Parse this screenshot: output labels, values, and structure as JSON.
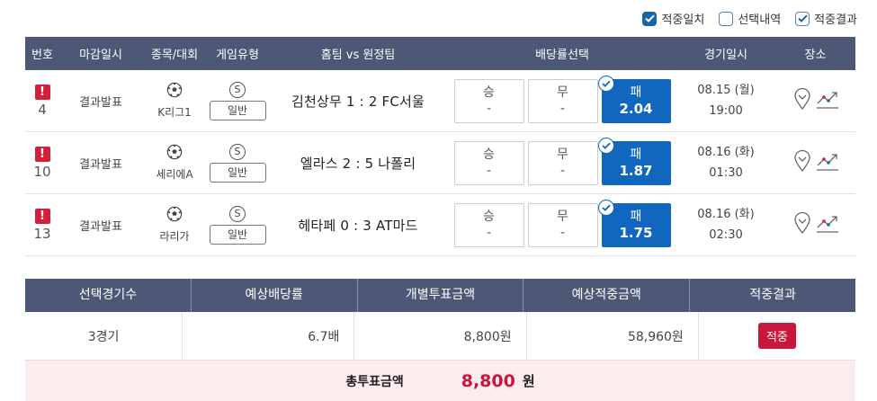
{
  "filters": [
    {
      "label": "적중일치",
      "checked": true
    },
    {
      "label": "선택내역",
      "checked": false
    },
    {
      "label": "적중결과",
      "checked": true
    }
  ],
  "match_table": {
    "headers": [
      "번호",
      "마감일시",
      "종목/대회",
      "게임유형",
      "홈팀 vs 원정팀",
      "배당률선택",
      "경기일시",
      "장소"
    ],
    "rows": [
      {
        "no": "4",
        "deadline": "결과발표",
        "league": "K리그1",
        "game_mark": "S",
        "game_type": "일반",
        "match": "김천상무 1 : 2 FC서울",
        "win_label": "승",
        "win_value": "-",
        "draw_label": "무",
        "draw_value": "-",
        "lose_label": "패",
        "lose_value": "2.04",
        "date": "08.15 (월)",
        "time": "19:00"
      },
      {
        "no": "10",
        "deadline": "결과발표",
        "league": "세리에A",
        "game_mark": "S",
        "game_type": "일반",
        "match": "엘라스 2 : 5 나폴리",
        "win_label": "승",
        "win_value": "-",
        "draw_label": "무",
        "draw_value": "-",
        "lose_label": "패",
        "lose_value": "1.87",
        "date": "08.16 (화)",
        "time": "01:30"
      },
      {
        "no": "13",
        "deadline": "결과발표",
        "league": "라리가",
        "game_mark": "S",
        "game_type": "일반",
        "match": "헤타페 0 : 3 AT마드",
        "win_label": "승",
        "win_value": "-",
        "draw_label": "무",
        "draw_value": "-",
        "lose_label": "패",
        "lose_value": "1.75",
        "date": "08.16 (화)",
        "time": "02:30"
      }
    ]
  },
  "summary": {
    "headers": [
      "선택경기수",
      "예상배당률",
      "개별투표금액",
      "예상적중금액",
      "적중결과"
    ],
    "games": "3경기",
    "odds": "6.7배",
    "bet_amount": "8,800원",
    "expected_win": "58,960원",
    "result": "적중",
    "total_label": "총투표금액",
    "total_value": "8,800",
    "total_unit": "원"
  },
  "colors": {
    "header": "#4d5876",
    "selected": "#1067bd",
    "hit": "#c8163c",
    "warn": "#d21f3c"
  },
  "icons": [
    "checkbox-icon",
    "alert-icon",
    "soccer-ball-icon",
    "location-pin-icon",
    "trend-chart-icon",
    "check-circle-icon"
  ]
}
